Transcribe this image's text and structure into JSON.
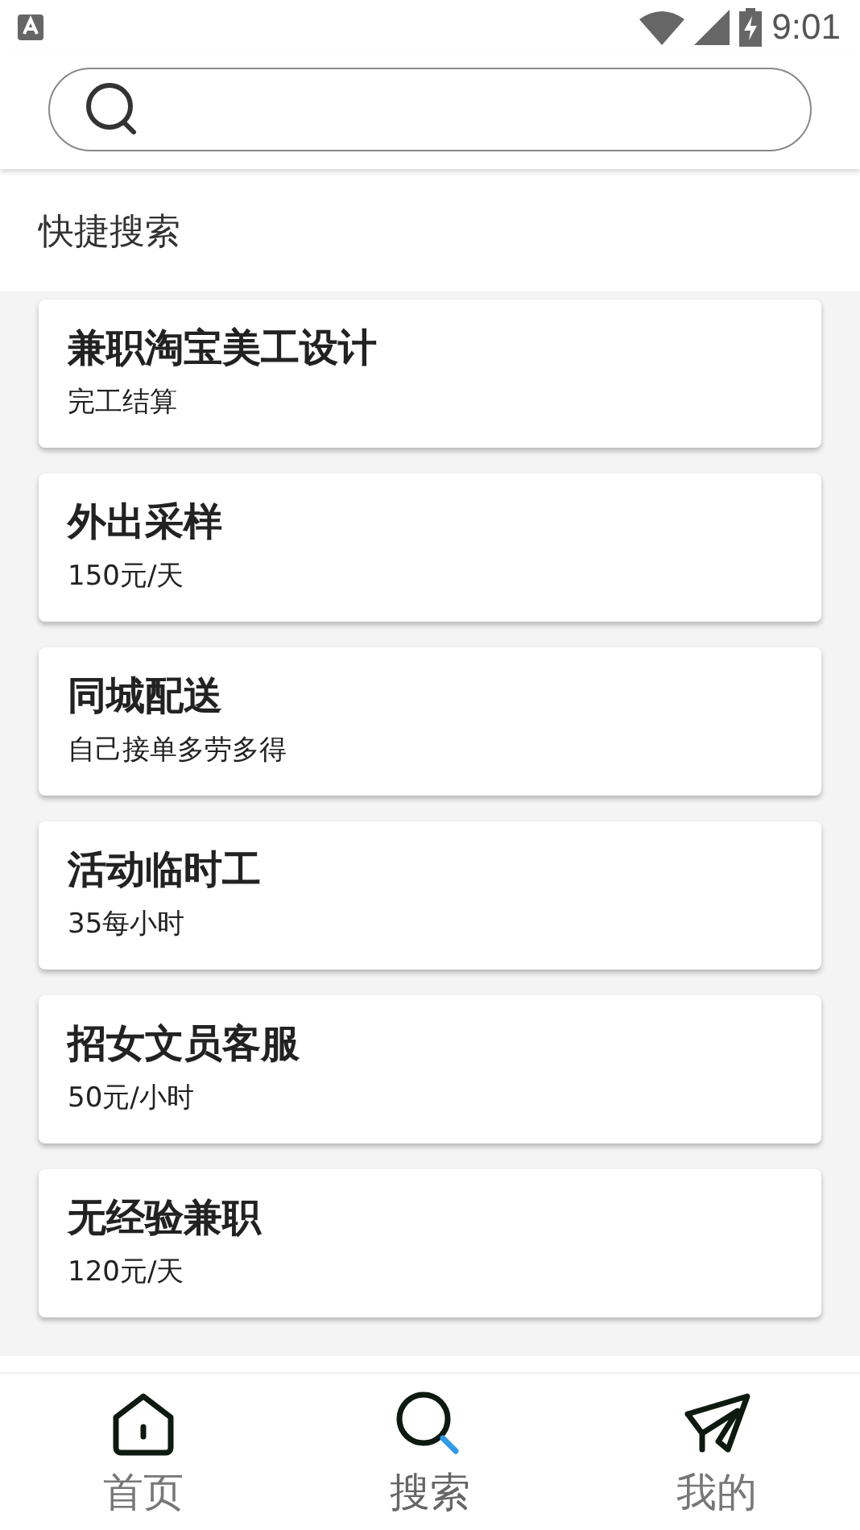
{
  "status_bar": {
    "time": "9:01"
  },
  "section_title": "快捷搜索",
  "jobs": [
    {
      "title": "兼职淘宝美工设计",
      "pay": "完工结算"
    },
    {
      "title": "外出采样",
      "pay": "150元/天"
    },
    {
      "title": "同城配送",
      "pay": "自己接单多劳多得"
    },
    {
      "title": "活动临时工",
      "pay": "35每小时"
    },
    {
      "title": "招女文员客服",
      "pay": "50元/小时"
    },
    {
      "title": "无经验兼职",
      "pay": "120元/天"
    }
  ],
  "nav": [
    {
      "kind": "home",
      "label": "首页",
      "selected": false
    },
    {
      "kind": "search",
      "label": "搜索",
      "selected": true
    },
    {
      "kind": "send",
      "label": "我的",
      "selected": false
    }
  ]
}
